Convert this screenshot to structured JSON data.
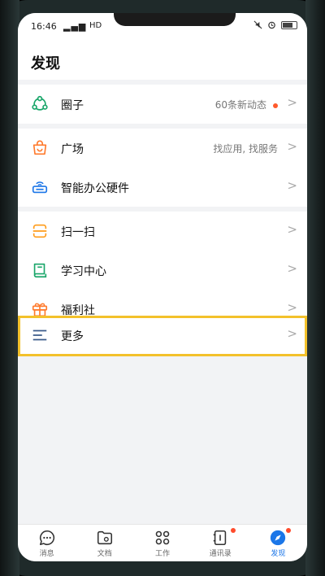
{
  "status_bar": {
    "time": "16:46",
    "signal": "▂▄▆",
    "network": "HD"
  },
  "header": {
    "title": "发现"
  },
  "groups": [
    {
      "items": [
        {
          "label": "圈子",
          "extra": "60条新动态",
          "chevron": ">"
        }
      ]
    },
    {
      "items": [
        {
          "label": "广场",
          "extra": "找应用, 找服务",
          "chevron": ">"
        },
        {
          "label": "智能办公硬件",
          "chevron": ">"
        }
      ]
    },
    {
      "items": [
        {
          "label": "扫一扫",
          "chevron": ">"
        },
        {
          "label": "学习中心",
          "chevron": ">"
        },
        {
          "label": "福利社",
          "chevron": ">"
        }
      ]
    },
    {
      "items": [
        {
          "label": "更多",
          "chevron": ">"
        }
      ]
    }
  ],
  "tabbar": [
    {
      "label": "消息",
      "icon": "message-icon"
    },
    {
      "label": "文档",
      "icon": "folder-icon"
    },
    {
      "label": "工作",
      "icon": "grid-icon"
    },
    {
      "label": "通讯录",
      "icon": "contacts-icon"
    },
    {
      "label": "发现",
      "icon": "discover-icon"
    }
  ],
  "colors": {
    "accent": "#1b76e8",
    "orange": "#ff7a2c",
    "green": "#1aa66a",
    "highlight": "#f3c12b"
  }
}
